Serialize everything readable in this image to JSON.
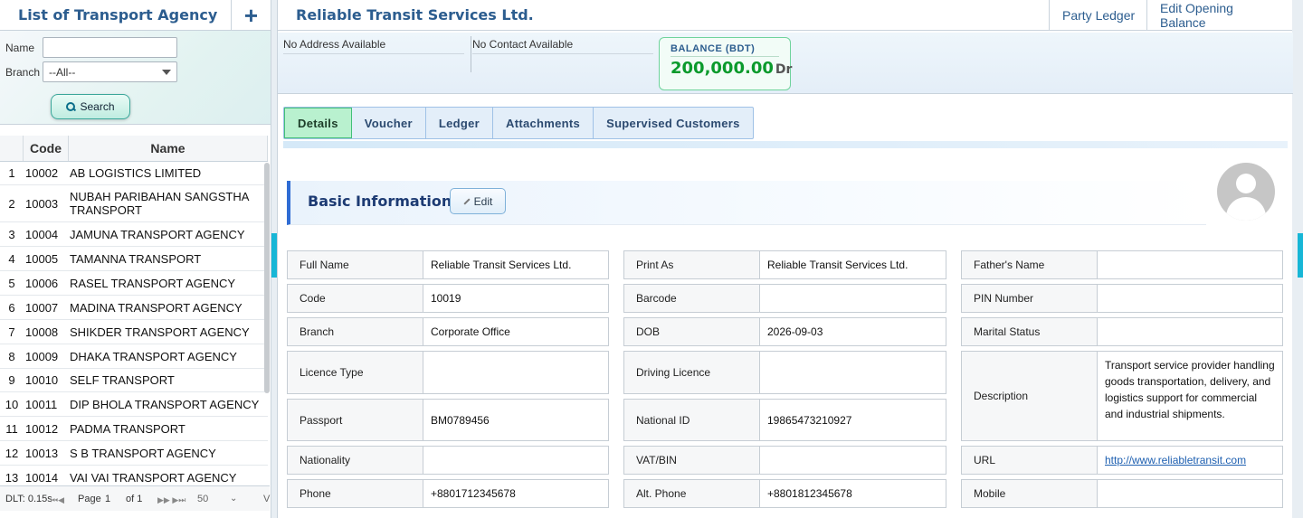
{
  "left_panel": {
    "title": "List of Transport Agency",
    "add_icon": "+",
    "filters": {
      "name_label": "Name",
      "name_value": "",
      "branch_label": "Branch",
      "branch_value": "--All--",
      "search_label": "Search"
    },
    "table": {
      "headers": [
        "",
        "Code",
        "Name"
      ],
      "rows": [
        {
          "n": "1",
          "code": "10002",
          "name": "AB LOGISTICS LIMITED"
        },
        {
          "n": "2",
          "code": "10003",
          "name": "NUBAH PARIBAHAN SANGSTHA TRANSPORT"
        },
        {
          "n": "3",
          "code": "10004",
          "name": "JAMUNA TRANSPORT AGENCY"
        },
        {
          "n": "4",
          "code": "10005",
          "name": "TAMANNA TRANSPORT"
        },
        {
          "n": "5",
          "code": "10006",
          "name": "RASEL TRANSPORT AGENCY"
        },
        {
          "n": "6",
          "code": "10007",
          "name": "MADINA TRANSPORT AGENCY"
        },
        {
          "n": "7",
          "code": "10008",
          "name": "SHIKDER TRANSPORT AGENCY"
        },
        {
          "n": "8",
          "code": "10009",
          "name": "DHAKA TRANSPORT AGENCY"
        },
        {
          "n": "9",
          "code": "10010",
          "name": "SELF TRANSPORT"
        },
        {
          "n": "10",
          "code": "10011",
          "name": "DIP BHOLA TRANSPORT AGENCY"
        },
        {
          "n": "11",
          "code": "10012",
          "name": "PADMA TRANSPORT"
        },
        {
          "n": "12",
          "code": "10013",
          "name": "S B TRANSPORT AGENCY"
        },
        {
          "n": "13",
          "code": "10014",
          "name": "VAI VAI TRANSPORT AGENCY"
        }
      ]
    },
    "footer": {
      "dlt": "DLT: 0.15s",
      "first_prev": "⏮◀",
      "page_label": "Page",
      "page_value": "1",
      "of_label": "of 1",
      "next_last": "▶▶ ▶⏭",
      "page_size": "50",
      "trailing": "V"
    }
  },
  "right_panel": {
    "title": "Reliable Transit Services Ltd.",
    "links": [
      "Party Ledger",
      "Edit Opening Balance"
    ],
    "address": "No Address Available",
    "contact": "No Contact Available",
    "balance_label": "BALANCE (BDT)",
    "balance_value": "200,000.00",
    "balance_type": "Dr",
    "tabs": [
      "Details",
      "Voucher",
      "Ledger",
      "Attachments",
      "Supervised Customers"
    ],
    "active_tab": "Details",
    "section_title": "Basic Information",
    "edit_label": "Edit",
    "fields": {
      "full_name": {
        "label": "Full Name",
        "value": "Reliable Transit Services Ltd."
      },
      "print_as": {
        "label": "Print As",
        "value": "Reliable Transit Services Ltd."
      },
      "fathers_name": {
        "label": "Father's Name",
        "value": ""
      },
      "code": {
        "label": "Code",
        "value": "10019"
      },
      "barcode": {
        "label": "Barcode",
        "value": ""
      },
      "pin_number": {
        "label": "PIN Number",
        "value": ""
      },
      "branch": {
        "label": "Branch",
        "value": "Corporate Office"
      },
      "dob": {
        "label": "DOB",
        "value": "2026-09-03"
      },
      "marital_status": {
        "label": "Marital Status",
        "value": ""
      },
      "licence_type": {
        "label": "Licence Type",
        "value": ""
      },
      "driving_licence": {
        "label": "Driving Licence",
        "value": ""
      },
      "description": {
        "label": "Description",
        "value": "Transport service provider handling goods transportation, delivery, and logistics support for commercial and industrial shipments."
      },
      "passport": {
        "label": "Passport",
        "value": "BM0789456"
      },
      "national_id": {
        "label": "National ID",
        "value": "19865473210927"
      },
      "nationality": {
        "label": "Nationality",
        "value": ""
      },
      "vat_bin": {
        "label": "VAT/BIN",
        "value": ""
      },
      "url": {
        "label": "URL",
        "value": "http://www.reliabletransit.com"
      },
      "phone": {
        "label": "Phone",
        "value": "+8801712345678"
      },
      "alt_phone": {
        "label": "Alt. Phone",
        "value": "+8801812345678"
      },
      "mobile": {
        "label": "Mobile",
        "value": ""
      }
    }
  }
}
